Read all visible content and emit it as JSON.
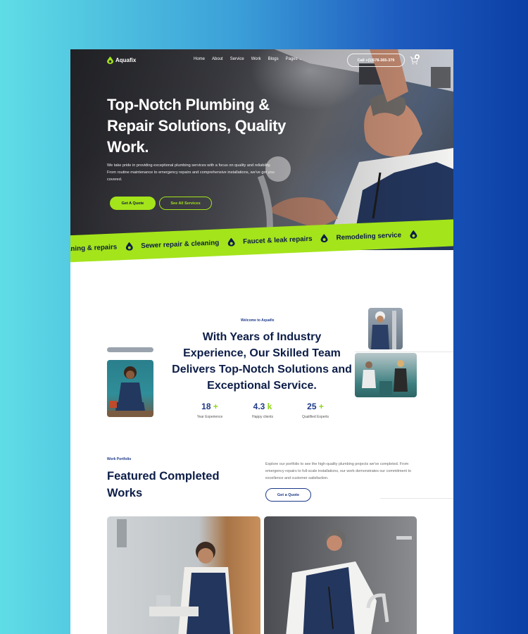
{
  "brand": {
    "name": "Aquafix",
    "accent": "#a4e41b",
    "navy": "#0c1d47"
  },
  "nav": {
    "links": [
      "Home",
      "About",
      "Service",
      "Work",
      "Blogs",
      "Pages"
    ],
    "call_label": "Call +(1)578-365-379",
    "cart_icon": "cart-icon",
    "cart_count": "0"
  },
  "hero": {
    "title": "Top-Notch Plumbing & Repair Solutions, Quality Work.",
    "description": "We take pride in providing exceptional plumbing services with a focus on quality and reliability. From routine maintenance to emergency repairs and comprehensive installations, we've got you covered.",
    "primary_button": "Get A Quote",
    "secondary_button": "See All Services"
  },
  "ribbon": {
    "items": [
      "leaning & repairs",
      "Sewer repair & cleaning",
      "Faucet & leak repairs",
      "Remodeling service"
    ]
  },
  "about": {
    "eyebrow": "Welcome to Aquafix",
    "title": "With Years of Industry Experience, Our Skilled Team Delivers Top-Notch Solutions and Exceptional Service.",
    "stats": [
      {
        "number": "18",
        "suffix": "+",
        "label": "Year Experience"
      },
      {
        "number": "4.3",
        "suffix": "k",
        "label": "Happy clients"
      },
      {
        "number": "25",
        "suffix": "+",
        "label": "Qualified Experts"
      }
    ]
  },
  "portfolio": {
    "eyebrow": "Work Portfolio",
    "title": "Featured Completed Works",
    "description": "Explore our portfolio to see the high-quality plumbing projects we've completed. From emergency repairs to full-scale installations, our work demonstrates our commitment to excellence and customer satisfaction.",
    "button": "Get a Quote"
  }
}
